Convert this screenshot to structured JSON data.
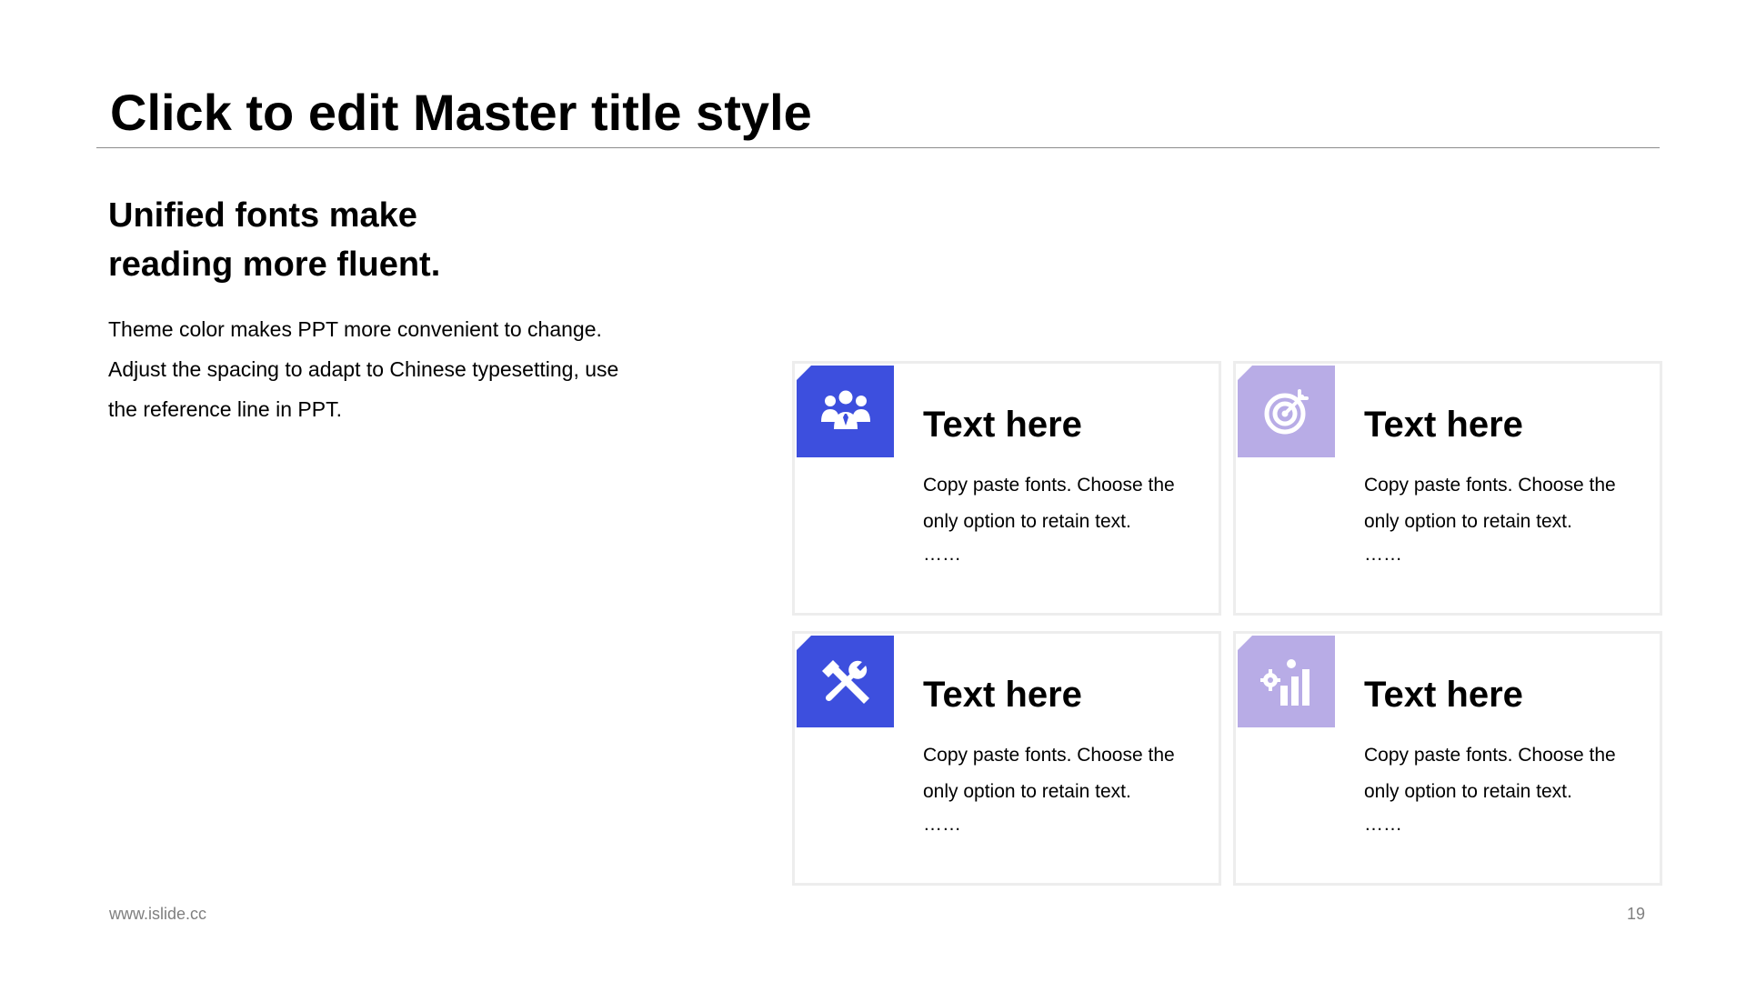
{
  "title": "Click to edit Master title style",
  "subtitle": {
    "line1": "Unified fonts make",
    "line2": "reading more fluent."
  },
  "body": {
    "line1": "Theme color makes PPT more convenient to change.",
    "line2": "Adjust the spacing to adapt to Chinese typesetting, use",
    "line3": "the reference line in PPT."
  },
  "colors": {
    "accent": "#3d4fde",
    "accent_light": "#b8ace6"
  },
  "cards": [
    {
      "icon": "team-icon",
      "title": "Text here",
      "desc_line1": "Copy paste fonts. Choose the",
      "desc_line2": "only option to retain text.",
      "ellipsis": "……"
    },
    {
      "icon": "target-icon",
      "title": "Text here",
      "desc_line1": "Copy paste fonts. Choose the",
      "desc_line2": "only option to retain text.",
      "ellipsis": "……"
    },
    {
      "icon": "tools-icon",
      "title": "Text here",
      "desc_line1": "Copy paste fonts. Choose the",
      "desc_line2": "only option to retain text.",
      "ellipsis": "……"
    },
    {
      "icon": "growth-chart-icon",
      "title": "Text here",
      "desc_line1": "Copy paste fonts. Choose the",
      "desc_line2": "only option to retain text.",
      "ellipsis": "……"
    }
  ],
  "footer": {
    "url": "www.islide.cc",
    "page": "19"
  }
}
